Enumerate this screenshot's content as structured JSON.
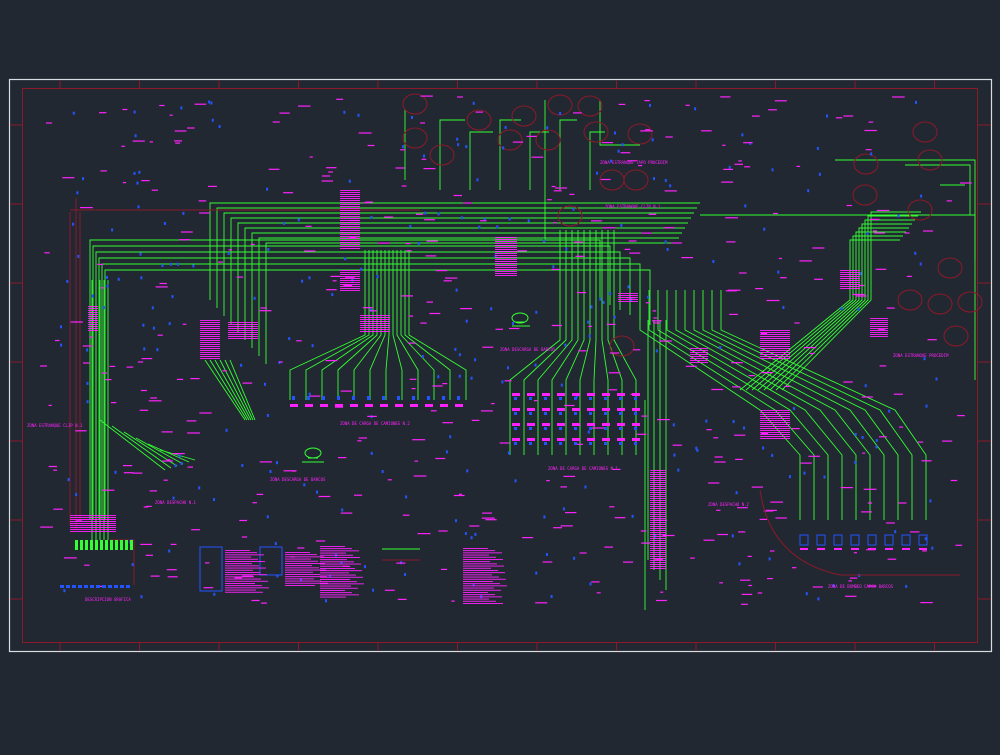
{
  "colors": {
    "background": "#222831",
    "frame": "#d8dde2",
    "border": "#8a1a2a",
    "pipe": "#33ff33",
    "label": "#ff22ff",
    "symbol": "#2255ff",
    "node": "#aa1133"
  },
  "zones": [
    {
      "id": "z1",
      "label": "ZONA ESTRANQUE TAPO PROCEDIM"
    },
    {
      "id": "z2",
      "label": "ZONA ESTRANQUE CLIP N.1"
    },
    {
      "id": "z3",
      "label": "ZONA DESCARGA DE BARCOS"
    },
    {
      "id": "z4",
      "label": "ZONA DE CARGA DE CAMIONES N.2"
    },
    {
      "id": "z5",
      "label": "ZONA DE CARGA DE CAMIONES N.1"
    },
    {
      "id": "z6",
      "label": "ZONA DESCARGA DE BARCOS"
    },
    {
      "id": "z7",
      "label": "ZONA DESPACHO N.1"
    },
    {
      "id": "z8",
      "label": "ZONA DESPACHO N.2"
    },
    {
      "id": "z9",
      "label": "ZONA ESTRANQUE PROCEDIM"
    },
    {
      "id": "z10",
      "label": "ZONA DE BOMBEO CARGA BARCOS"
    },
    {
      "id": "z11",
      "label": "ZONA ESTRANQUE CLIP N.1"
    },
    {
      "id": "z12",
      "label": "DESCRIPCION GRAFICA"
    }
  ]
}
